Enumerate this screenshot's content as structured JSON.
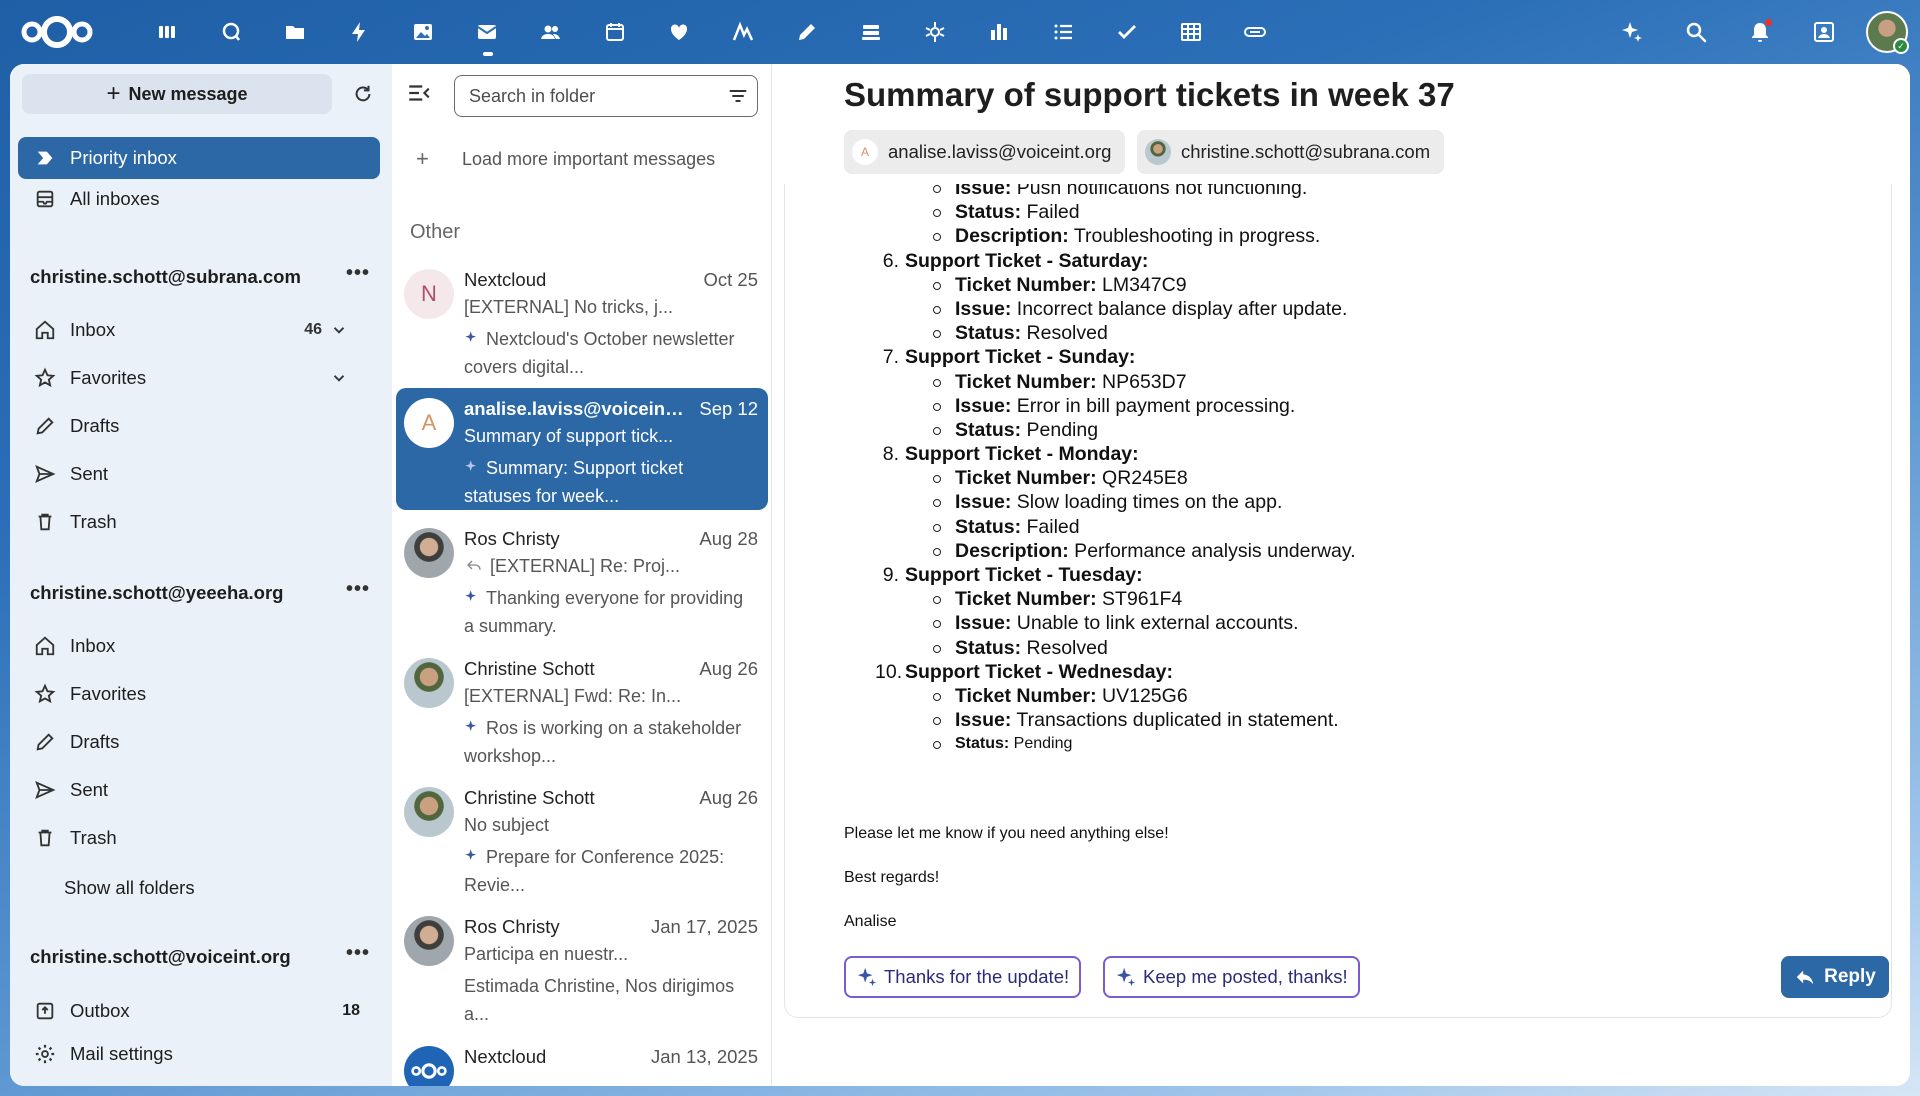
{
  "apps": [
    {
      "icon": "dashboard-icon"
    },
    {
      "icon": "talk-icon"
    },
    {
      "icon": "files-icon"
    },
    {
      "icon": "activity-icon"
    },
    {
      "icon": "photos-icon"
    },
    {
      "icon": "mail-icon",
      "active": true
    },
    {
      "icon": "contacts-icon"
    },
    {
      "icon": "calendar-icon"
    },
    {
      "icon": "health-icon"
    },
    {
      "icon": "analytics-icon"
    },
    {
      "icon": "notes-icon"
    },
    {
      "icon": "deck-icon"
    },
    {
      "icon": "assistant-icon"
    },
    {
      "icon": "charts-icon"
    },
    {
      "icon": "tasks-icon"
    },
    {
      "icon": "checklist-icon"
    },
    {
      "icon": "tables-icon"
    },
    {
      "icon": "ocs-icon"
    }
  ],
  "nav": {
    "new_message": "New message",
    "priority_inbox": "Priority inbox",
    "all_inboxes": "All inboxes",
    "accounts": [
      {
        "email": "christine.schott@subrana.com",
        "inbox": "Inbox",
        "inbox_count": "46",
        "favorites": "Favorites",
        "drafts": "Drafts",
        "sent": "Sent",
        "trash": "Trash"
      },
      {
        "email": "christine.schott@yeeeha.org",
        "inbox": "Inbox",
        "favorites": "Favorites",
        "drafts": "Drafts",
        "sent": "Sent",
        "trash": "Trash",
        "show_all": "Show all folders"
      },
      {
        "email": "christine.schott@voiceint.org",
        "outbox": "Outbox",
        "outbox_count": "18",
        "mail_settings": "Mail settings"
      }
    ]
  },
  "list": {
    "search_placeholder": "Search in folder",
    "load_more": "Load more important messages",
    "section_other": "Other",
    "messages": [
      {
        "from": "Nextcloud",
        "date": "Oct 25",
        "subject": "[EXTERNAL] No tricks, j...",
        "preview": "Nextcloud's October newsletter covers digital...",
        "initial": "N"
      },
      {
        "from": "analise.laviss@voiceint....",
        "date": "Sep 12",
        "subject": "Summary of support tick...",
        "preview": "Summary: Support ticket statuses for week...",
        "initial": "A"
      },
      {
        "from": "Ros Christy",
        "date": "Aug 28",
        "subject": "[EXTERNAL] Re: Proj...",
        "preview": "Thanking everyone for providing a summary."
      },
      {
        "from": "Christine Schott",
        "date": "Aug 26",
        "subject": "[EXTERNAL] Fwd: Re: In...",
        "preview": "Ros is working on a stakeholder workshop..."
      },
      {
        "from": "Christine Schott",
        "date": "Aug 26",
        "subject": "No subject",
        "preview": "Prepare for Conference 2025: Revie..."
      },
      {
        "from": "Ros Christy",
        "date": "Jan 17, 2025",
        "subject": "Participa en nuestr...",
        "preview": "Estimada Christine, Nos dirigimos a..."
      },
      {
        "from": "Nextcloud",
        "date": "Jan 13, 2025"
      }
    ]
  },
  "message": {
    "subject": "Summary of support tickets in week 37",
    "from_chip": "analise.laviss@voiceint.org",
    "from_initial": "A",
    "to_chip": "christine.schott@subrana.com",
    "lines": [
      {
        "kind": "sub",
        "label": "Issue:",
        "value": " Push notifications not functioning."
      },
      {
        "kind": "sub",
        "label": "Status:",
        "value": " Failed"
      },
      {
        "kind": "sub",
        "label": "Description:",
        "value": " Troubleshooting in progress."
      },
      {
        "kind": "num",
        "n": "6.",
        "label": "Support Ticket - Saturday:"
      },
      {
        "kind": "sub",
        "label": "Ticket Number:",
        "value": " LM347C9"
      },
      {
        "kind": "sub",
        "label": "Issue:",
        "value": " Incorrect balance display after update."
      },
      {
        "kind": "sub",
        "label": "Status:",
        "value": " Resolved"
      },
      {
        "kind": "num",
        "n": "7.",
        "label": "Support Ticket - Sunday:"
      },
      {
        "kind": "sub",
        "label": "Ticket Number:",
        "value": " NP653D7"
      },
      {
        "kind": "sub",
        "label": "Issue:",
        "value": " Error in bill payment processing."
      },
      {
        "kind": "sub",
        "label": "Status:",
        "value": " Pending"
      },
      {
        "kind": "num",
        "n": "8.",
        "label": "Support Ticket - Monday:"
      },
      {
        "kind": "sub",
        "label": "Ticket Number:",
        "value": " QR245E8"
      },
      {
        "kind": "sub",
        "label": "Issue:",
        "value": " Slow loading times on the app."
      },
      {
        "kind": "sub",
        "label": "Status:",
        "value": " Failed"
      },
      {
        "kind": "sub",
        "label": "Description:",
        "value": " Performance analysis underway."
      },
      {
        "kind": "num",
        "n": "9.",
        "label": "Support Ticket - Tuesday:"
      },
      {
        "kind": "sub",
        "label": "Ticket Number:",
        "value": " ST961F4"
      },
      {
        "kind": "sub",
        "label": "Issue:",
        "value": " Unable to link external accounts."
      },
      {
        "kind": "sub",
        "label": "Status:",
        "value": " Resolved"
      },
      {
        "kind": "num",
        "n": "10.",
        "label": "Support Ticket - Wednesday:"
      },
      {
        "kind": "sub",
        "label": "Ticket Number:",
        "value": " UV125G6"
      },
      {
        "kind": "sub",
        "label": "Issue:",
        "value": " Transactions duplicated in statement."
      },
      {
        "kind": "sub",
        "small": true,
        "label": "Status:",
        "value": " Pending"
      }
    ],
    "closing1": "Please let me know if you need anything else!",
    "closing2": "Best regards!",
    "closing3": "Analise",
    "smart_reply_1": "Thanks for the update!",
    "smart_reply_2": "Keep me posted, thanks!",
    "reply": "Reply"
  },
  "colors": {
    "primary": "#2c67a6",
    "smart_border": "#7b5bd2"
  }
}
